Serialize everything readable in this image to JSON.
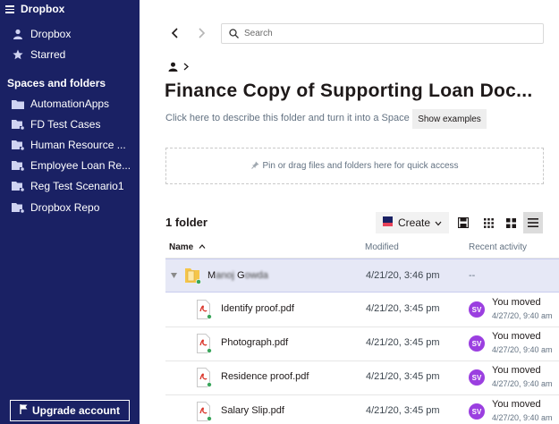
{
  "sidebar": {
    "app_title": "Dropbox",
    "nav": [
      {
        "label": "Dropbox",
        "icon": "person-icon"
      },
      {
        "label": "Starred",
        "icon": "star-icon"
      }
    ],
    "section_title": "Spaces and folders",
    "folders": [
      {
        "label": "AutomationApps",
        "icon": "folder-icon"
      },
      {
        "label": "FD Test Cases",
        "icon": "shared-folder-icon"
      },
      {
        "label": "Human Resource ...",
        "icon": "shared-folder-icon"
      },
      {
        "label": "Employee Loan Re...",
        "icon": "shared-folder-icon"
      },
      {
        "label": "Reg Test Scenario1",
        "icon": "shared-folder-icon"
      },
      {
        "label": "Dropbox Repo",
        "icon": "shared-folder-icon"
      }
    ],
    "upgrade_label": "Upgrade account"
  },
  "search": {
    "placeholder": "Search"
  },
  "page": {
    "title": "Finance Copy of Supporting Loan Doc...",
    "description": "Click here to describe this folder and turn it into a Space",
    "show_examples": "Show examples",
    "dropzone": "Pin or drag files and folders here for quick access",
    "count": "1 folder",
    "create_label": "Create"
  },
  "table": {
    "headers": {
      "name": "Name",
      "modified": "Modified",
      "activity": "Recent activity"
    },
    "folder_row": {
      "name_start": "M",
      "name_blur1": "anoj",
      "name_mid": "G",
      "name_blur2": "owda",
      "modified": "4/21/20, 3:46 pm",
      "activity": "--"
    },
    "files": [
      {
        "name": "Identify proof.pdf",
        "modified": "4/21/20, 3:45 pm",
        "initials": "SV",
        "activity": "You moved",
        "activity_time": "4/27/20, 9:40 am"
      },
      {
        "name": "Photograph.pdf",
        "modified": "4/21/20, 3:45 pm",
        "initials": "SV",
        "activity": "You moved",
        "activity_time": "4/27/20, 9:40 am"
      },
      {
        "name": "Residence proof.pdf",
        "modified": "4/21/20, 3:45 pm",
        "initials": "SV",
        "activity": "You moved",
        "activity_time": "4/27/20, 9:40 am"
      },
      {
        "name": "Salary Slip.pdf",
        "modified": "4/21/20, 3:45 pm",
        "initials": "SV",
        "activity": "You moved",
        "activity_time": "4/27/20, 9:40 am"
      }
    ]
  },
  "colors": {
    "sidebar_bg": "#1a2164",
    "avatar": "#9b3fe0",
    "pdf_red": "#d93025",
    "selected_row": "#e6e8f6"
  }
}
